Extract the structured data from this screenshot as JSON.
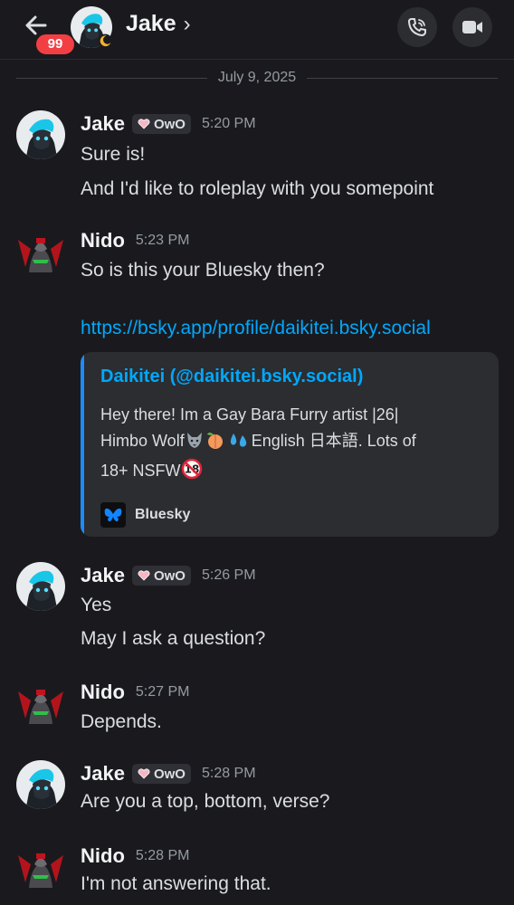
{
  "header": {
    "badge_count": "99",
    "title": "Jake",
    "chevron": "›"
  },
  "date_separator": "July 9, 2025",
  "messages": [
    {
      "author": "Jake",
      "tag": "OwO",
      "time": "5:20 PM",
      "lines": [
        "Sure is!",
        "And I'd like to roleplay with you somepoint"
      ]
    },
    {
      "author": "Nido",
      "time": "5:23 PM",
      "lines": [
        "So is this your Bluesky then?"
      ],
      "link": "https://bsky.app/profile/daikitei.bsky.social"
    },
    {
      "author": "Jake",
      "tag": "OwO",
      "time": "5:26 PM",
      "lines": [
        "Yes",
        "May I ask a question?"
      ]
    },
    {
      "author": "Nido",
      "time": "5:27 PM",
      "lines": [
        "Depends."
      ]
    },
    {
      "author": "Jake",
      "tag": "OwO",
      "time": "5:28 PM",
      "lines": [
        "Are you a top, bottom, verse?"
      ]
    },
    {
      "author": "Nido",
      "time": "5:28 PM",
      "lines": [
        "I'm not answering that."
      ]
    }
  ],
  "embed": {
    "title": "Daikitei (@daikitei.bsky.social)",
    "desc_line1": "Hey there! Im a Gay Bara Furry artist |26|",
    "desc_line2a": "Himbo Wolf",
    "desc_line2b": "English 日本語. Lots of",
    "desc_line3": "18+ NSFW",
    "provider": "Bluesky"
  },
  "colors": {
    "background": "#1a1a1e",
    "link": "#00a8fc",
    "badge": "#f23f43",
    "embed_bar": "#1d8cf8"
  }
}
